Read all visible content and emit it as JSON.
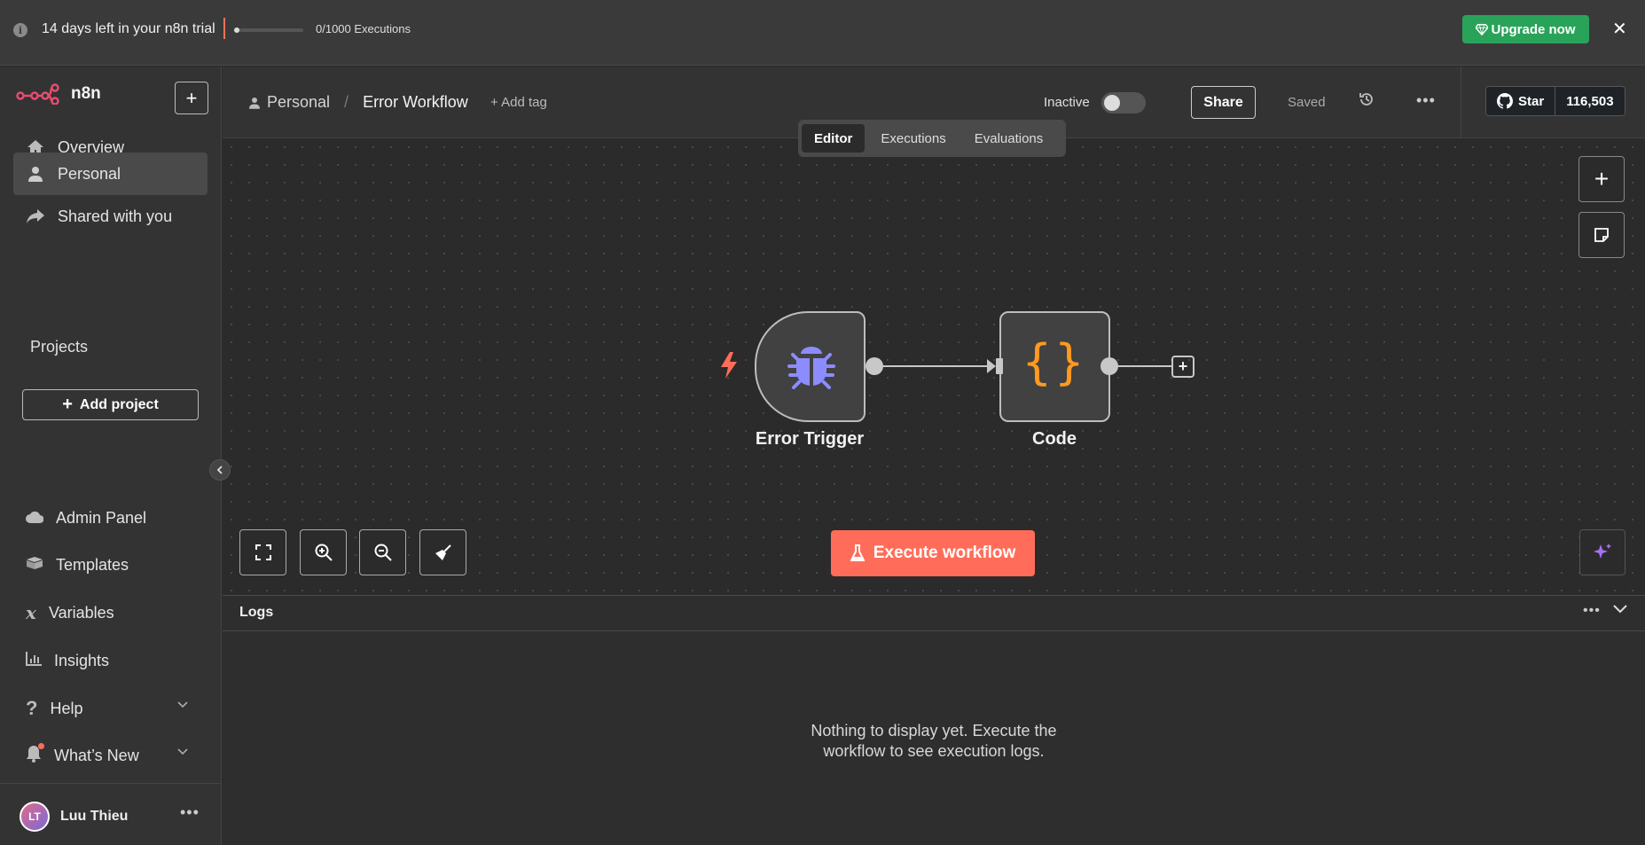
{
  "banner": {
    "trial_text": "14 days left in your n8n trial",
    "executions_text": "0/1000 Executions",
    "executions_progress": 0.0,
    "upgrade_label": "Upgrade now",
    "close_label": "✕"
  },
  "sidebar": {
    "brand": "n8n",
    "nav": [
      {
        "label": "Overview",
        "icon": "home-icon"
      },
      {
        "label": "Personal",
        "icon": "user-icon",
        "active": true
      },
      {
        "label": "Shared with you",
        "icon": "share-icon"
      }
    ],
    "projects_label": "Projects",
    "add_project_label": "Add project",
    "bottom": [
      {
        "label": "Admin Panel",
        "icon": "cloud-icon"
      },
      {
        "label": "Templates",
        "icon": "box-icon"
      },
      {
        "label": "Variables",
        "icon": "variable-icon"
      },
      {
        "label": "Insights",
        "icon": "chart-icon"
      },
      {
        "label": "Help",
        "icon": "question-icon"
      },
      {
        "label": "What’s New",
        "icon": "bell-icon"
      }
    ],
    "user": {
      "initials": "LT",
      "name": "Luu Thieu"
    }
  },
  "header": {
    "project": "Personal",
    "workflow_name": "Error Workflow",
    "add_tag": "+ Add tag",
    "status": "Inactive",
    "share_label": "Share",
    "saved_label": "Saved",
    "github_star": "Star",
    "github_count": "116,503"
  },
  "tabs": [
    "Editor",
    "Executions",
    "Evaluations"
  ],
  "canvas": {
    "nodes": [
      {
        "label": "Error Trigger",
        "icon": "bug-icon"
      },
      {
        "label": "Code",
        "icon": "code-braces-icon"
      }
    ],
    "execute_label": "Execute workflow"
  },
  "logs": {
    "title": "Logs",
    "empty_line1": "Nothing to display yet. Execute the",
    "empty_line2": "workflow to see execution logs."
  },
  "colors": {
    "accent": "#ff6d5a",
    "upgrade": "#2aa35a",
    "trigger_icon": "#8c8cff",
    "code_icon": "#ff9a1f"
  }
}
